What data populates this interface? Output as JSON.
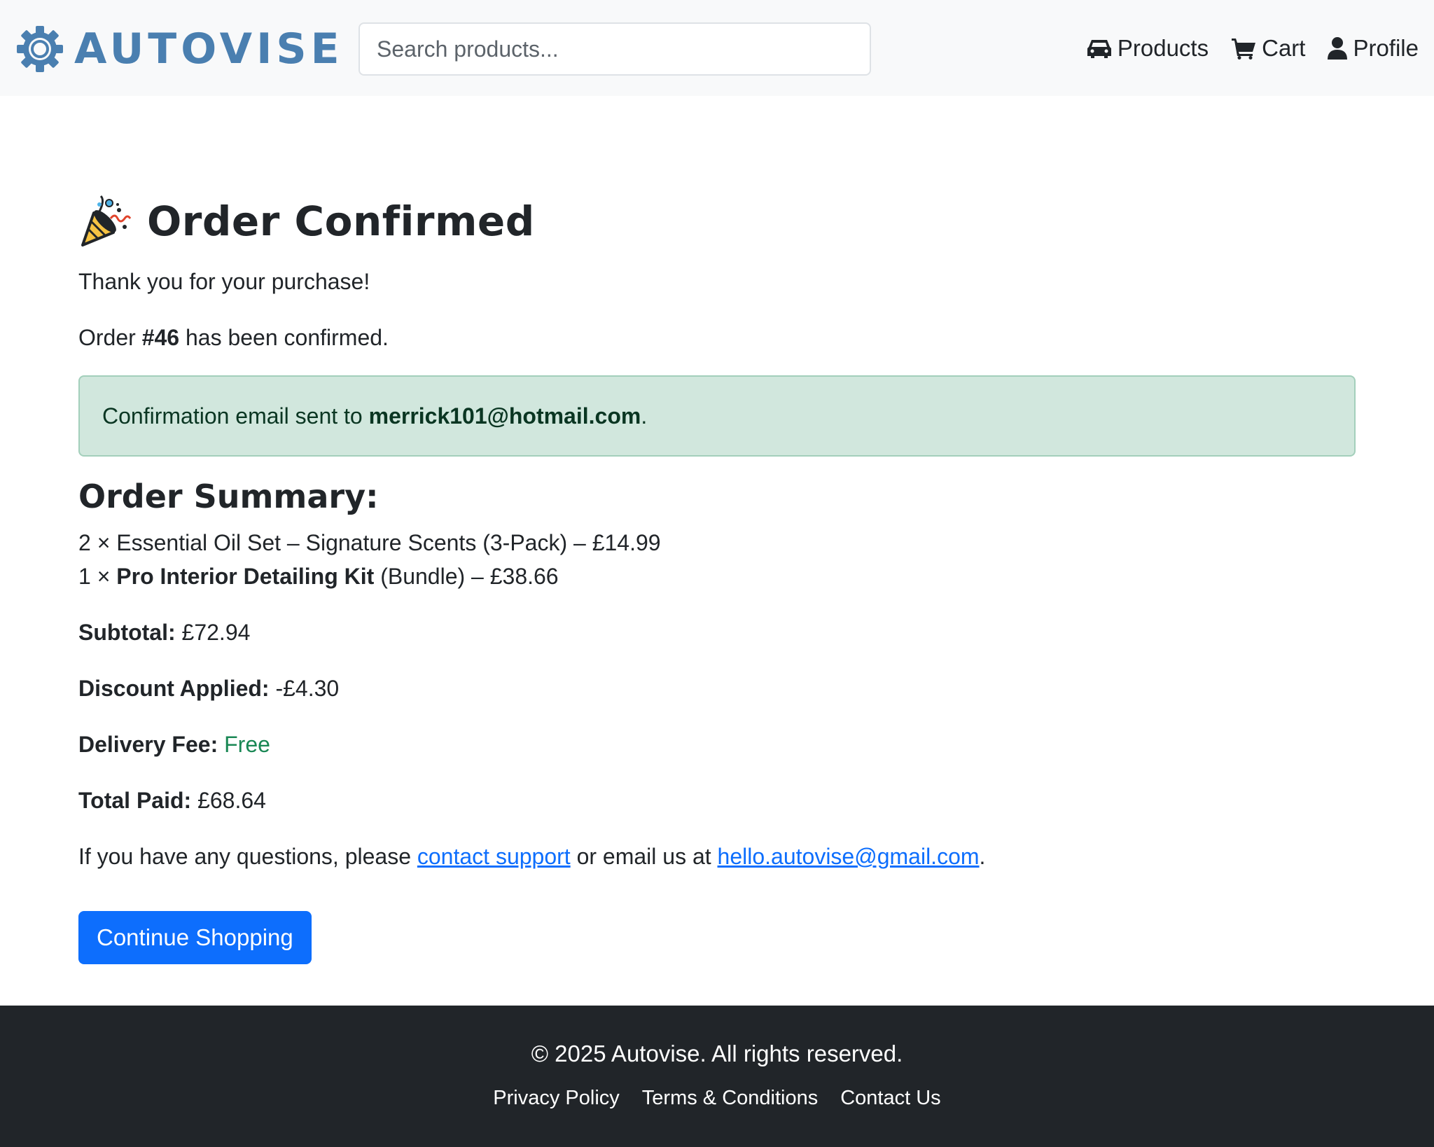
{
  "header": {
    "brand": "AUTOVISE",
    "search_placeholder": "Search products...",
    "nav": [
      {
        "label": "Products",
        "icon": "car-icon"
      },
      {
        "label": "Cart",
        "icon": "cart-icon"
      },
      {
        "label": "Profile",
        "icon": "user-icon"
      }
    ]
  },
  "main": {
    "title": "Order Confirmed",
    "title_icon": "party-popper-icon",
    "thanks": "Thank you for your purchase!",
    "order_prefix": "Order ",
    "order_number": "#46",
    "order_suffix": " has been confirmed.",
    "alert_prefix": "Confirmation email sent to ",
    "alert_email": "merrick101@hotmail.com",
    "alert_suffix": ".",
    "summary_heading": "Order Summary:",
    "items": [
      {
        "qty": "2 × ",
        "name": "Essential Oil Set – Signature Scents (3-Pack)",
        "bold": false,
        "suffix": " – £14.99"
      },
      {
        "qty": "1 × ",
        "name": "Pro Interior Detailing Kit",
        "bold": true,
        "suffix": " (Bundle) – £38.66"
      }
    ],
    "subtotal_label": "Subtotal:",
    "subtotal_value": " £72.94",
    "discount_label": "Discount Applied:",
    "discount_value": " -£4.30",
    "delivery_label": "Delivery Fee:",
    "delivery_value": "Free",
    "total_label": "Total Paid:",
    "total_value": " £68.64",
    "help_prefix": "If you have any questions, please ",
    "help_link": "contact support",
    "help_middle": " or email us at ",
    "help_email": "hello.autovise@gmail.com",
    "help_suffix": ".",
    "continue_button": "Continue Shopping"
  },
  "footer": {
    "copyright": "© 2025 Autovise. All rights reserved.",
    "links": [
      "Privacy Policy",
      "Terms & Conditions",
      "Contact Us"
    ]
  },
  "colors": {
    "brand": "#4a7fb0",
    "primary": "#0d6efd",
    "success_bg": "#d1e7dd",
    "success_text": "#198754",
    "footer_bg": "#212529"
  }
}
